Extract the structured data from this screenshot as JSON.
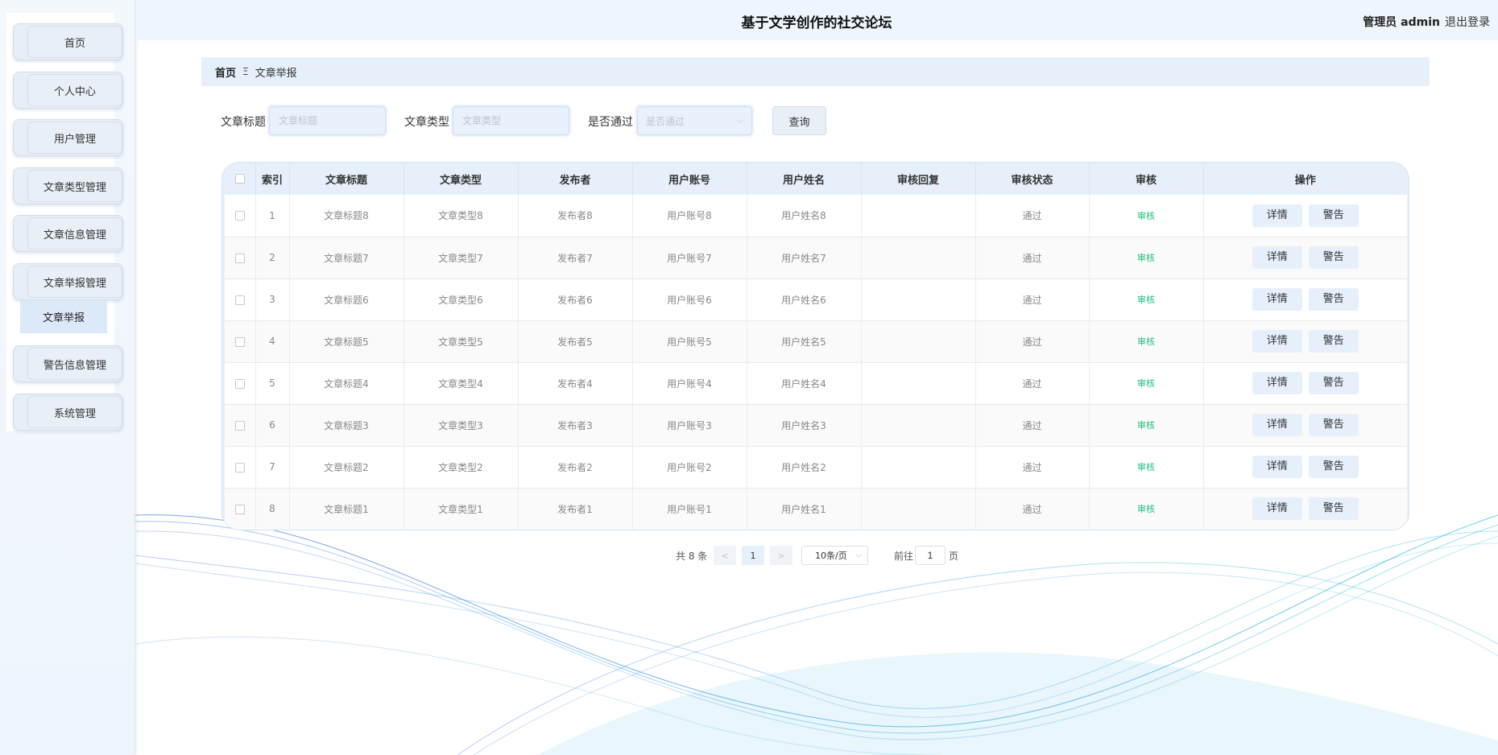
{
  "header": {
    "title": "基于文学创作的社交论坛",
    "user": "管理员 admin",
    "logout": "退出登录"
  },
  "sidebar": {
    "items": [
      {
        "label": "首页"
      },
      {
        "label": "个人中心"
      },
      {
        "label": "用户管理"
      },
      {
        "label": "文章类型管理"
      },
      {
        "label": "文章信息管理"
      },
      {
        "label": "文章举报管理"
      },
      {
        "label": "警告信息管理"
      },
      {
        "label": "系统管理"
      }
    ],
    "sub_item": "文章举报"
  },
  "breadcrumb": {
    "home": "首页",
    "separator": "Ξ",
    "current": "文章举报"
  },
  "search": {
    "title_label": "文章标题",
    "title_placeholder": "文章标题",
    "type_label": "文章类型",
    "type_placeholder": "文章类型",
    "pass_label": "是否通过",
    "pass_placeholder": "是否通过",
    "query_label": "查询"
  },
  "table": {
    "headers": [
      "索引",
      "文章标题",
      "文章类型",
      "发布者",
      "用户账号",
      "用户姓名",
      "审核回复",
      "审核状态",
      "审核",
      "操作"
    ],
    "rows": [
      {
        "index": "1",
        "title": "文章标题8",
        "type": "文章类型8",
        "publisher": "发布者8",
        "account": "用户账号8",
        "name": "用户姓名8",
        "reply": "",
        "status": "通过"
      },
      {
        "index": "2",
        "title": "文章标题7",
        "type": "文章类型7",
        "publisher": "发布者7",
        "account": "用户账号7",
        "name": "用户姓名7",
        "reply": "",
        "status": "通过"
      },
      {
        "index": "3",
        "title": "文章标题6",
        "type": "文章类型6",
        "publisher": "发布者6",
        "account": "用户账号6",
        "name": "用户姓名6",
        "reply": "",
        "status": "通过"
      },
      {
        "index": "4",
        "title": "文章标题5",
        "type": "文章类型5",
        "publisher": "发布者5",
        "account": "用户账号5",
        "name": "用户姓名5",
        "reply": "",
        "status": "通过"
      },
      {
        "index": "5",
        "title": "文章标题4",
        "type": "文章类型4",
        "publisher": "发布者4",
        "account": "用户账号4",
        "name": "用户姓名4",
        "reply": "",
        "status": "通过"
      },
      {
        "index": "6",
        "title": "文章标题3",
        "type": "文章类型3",
        "publisher": "发布者3",
        "account": "用户账号3",
        "name": "用户姓名3",
        "reply": "",
        "status": "通过"
      },
      {
        "index": "7",
        "title": "文章标题2",
        "type": "文章类型2",
        "publisher": "发布者2",
        "account": "用户账号2",
        "name": "用户姓名2",
        "reply": "",
        "status": "通过"
      },
      {
        "index": "8",
        "title": "文章标题1",
        "type": "文章类型1",
        "publisher": "发布者1",
        "account": "用户账号1",
        "name": "用户姓名1",
        "reply": "",
        "status": "通过"
      }
    ],
    "review_label": "审核",
    "detail_label": "详情",
    "warn_label": "警告",
    "review_color": "#1ec07d"
  },
  "pagination": {
    "total": "共 8 条",
    "prev": "<",
    "current_page": "1",
    "next": ">",
    "page_size": "10条/页",
    "goto_label": "前往",
    "goto_value": "1",
    "page_unit": "页"
  }
}
